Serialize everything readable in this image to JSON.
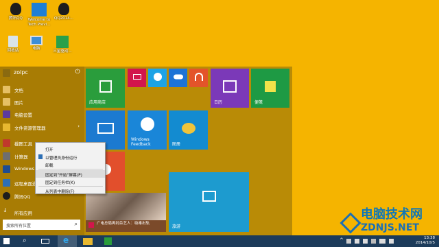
{
  "desktop": {
    "icons": [
      {
        "label": "腾讯QQ"
      },
      {
        "label": "Welcome to Tech Previ..."
      },
      {
        "label": "QQ2014..."
      },
      {
        "label": "回收站"
      },
      {
        "label": "电脑"
      },
      {
        "label": "三星驱动..."
      }
    ]
  },
  "start_menu": {
    "user_name": "zolpc",
    "items": [
      {
        "label": "文档"
      },
      {
        "label": "图片"
      },
      {
        "label": "电脑设置"
      },
      {
        "label": "文件资源管理器"
      },
      {
        "label": "截图工具"
      },
      {
        "label": "计算器"
      },
      {
        "label": "Windows P..."
      },
      {
        "label": "远程桌面连接"
      },
      {
        "label": "腾讯QQ"
      }
    ],
    "all_apps": "所有应用",
    "search_placeholder": "搜索所有位置",
    "tiles": {
      "store": "应用商店",
      "calendar": "日历",
      "notes": "便笺",
      "feedback": "Windows Feedback",
      "pictures": "图册",
      "travel": "旅游",
      "news": "广电总局再封杀艺人：吸毒出轨"
    }
  },
  "context_menu": {
    "items": [
      {
        "label": "打开"
      },
      {
        "label": "以管理员身份运行"
      },
      {
        "label": "卸载"
      },
      {
        "label": "固定到\"开始\"屏幕(P)"
      },
      {
        "label": "固定到任务栏(K)"
      },
      {
        "label": "从列表中删除(F)"
      }
    ]
  },
  "taskbar": {
    "time": "13:38",
    "date": "2014/10/5"
  },
  "watermark": {
    "line1": "电脑技术网",
    "line2": "ZDNJS.NET"
  }
}
